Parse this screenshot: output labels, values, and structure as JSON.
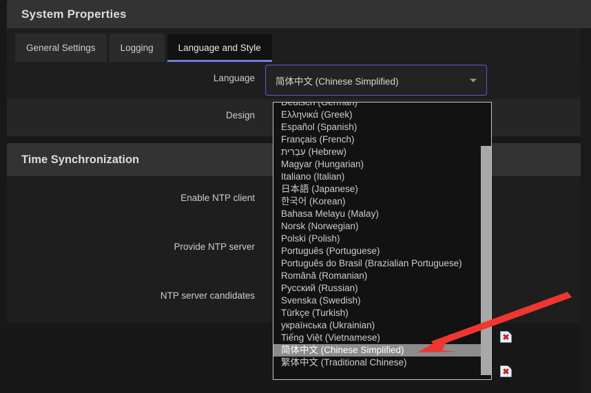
{
  "window": {
    "title": "System Properties"
  },
  "tabs": [
    {
      "label": "General Settings",
      "active": false
    },
    {
      "label": "Logging",
      "active": false
    },
    {
      "label": "Language and Style",
      "active": true
    }
  ],
  "colors": {
    "accent": "#6f7fe0",
    "combobox_border": "#6a55c8",
    "selected_item_bg": "#8c8c8c",
    "annotation_arrow": "#f0362f",
    "titlebar_bg": "#333333",
    "panel_bg": "#1e1e1e",
    "row_alt_bg": "#262626"
  },
  "language_section": {
    "rows": [
      {
        "label": "Language",
        "band": "band-dark"
      },
      {
        "label": "Design",
        "band": "band-light"
      }
    ],
    "combobox": {
      "value": "简体中文 (Chinese Simplified)",
      "caret_icon": "chevron-down-icon",
      "expanded": true
    }
  },
  "dropdown": {
    "items": [
      {
        "label": "Deutsch (German)",
        "selected": false
      },
      {
        "label": "Ελληνικά (Greek)",
        "selected": false
      },
      {
        "label": "Español (Spanish)",
        "selected": false
      },
      {
        "label": "Français (French)",
        "selected": false
      },
      {
        "label": "עִבְרִית (Hebrew)",
        "selected": false
      },
      {
        "label": "Magyar (Hungarian)",
        "selected": false
      },
      {
        "label": "Italiano (Italian)",
        "selected": false
      },
      {
        "label": "日本語 (Japanese)",
        "selected": false
      },
      {
        "label": "한국어 (Korean)",
        "selected": false
      },
      {
        "label": "Bahasa Melayu (Malay)",
        "selected": false
      },
      {
        "label": "Norsk (Norwegian)",
        "selected": false
      },
      {
        "label": "Polski (Polish)",
        "selected": false
      },
      {
        "label": "Português (Portuguese)",
        "selected": false
      },
      {
        "label": "Português do Brasil (Brazialian Portuguese)",
        "selected": false
      },
      {
        "label": "Română (Romanian)",
        "selected": false
      },
      {
        "label": "Русский (Russian)",
        "selected": false
      },
      {
        "label": "Svenska (Swedish)",
        "selected": false
      },
      {
        "label": "Türkçe (Turkish)",
        "selected": false
      },
      {
        "label": "українська (Ukrainian)",
        "selected": false
      },
      {
        "label": "Tiếng Việt (Vietnamese)",
        "selected": false
      },
      {
        "label": "简体中文 (Chinese Simplified)",
        "selected": true
      },
      {
        "label": "繁体中文 (Traditional Chinese)",
        "selected": false
      }
    ]
  },
  "time_section": {
    "title": "Time Synchronization",
    "rows": [
      {
        "label": "Enable NTP client",
        "icon": null
      },
      {
        "label": "Provide NTP server",
        "icon": null
      },
      {
        "label": "NTP server candidates",
        "icon": "broken-image-icon"
      }
    ],
    "broken_icons": [
      {
        "name": "broken-image-icon",
        "glyph": "✖"
      },
      {
        "name": "broken-image-icon",
        "glyph": "✖"
      }
    ]
  }
}
